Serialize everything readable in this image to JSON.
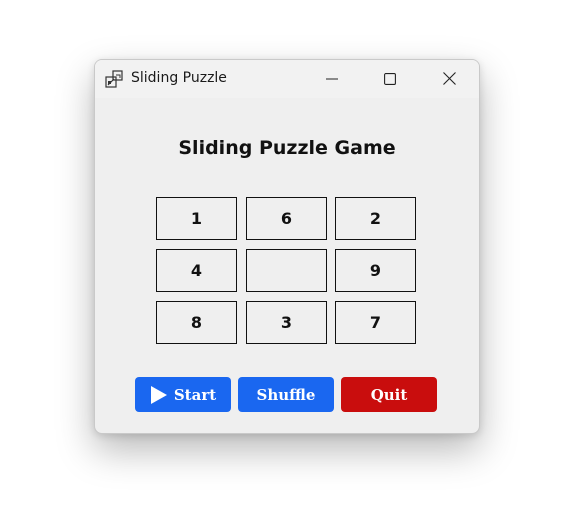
{
  "window": {
    "title": "Sliding Puzzle",
    "controls": {
      "minimize_icon": "minimize-icon",
      "maximize_icon": "maximize-icon",
      "close_icon": "close-icon"
    }
  },
  "game": {
    "heading": "Sliding Puzzle Game",
    "tiles": [
      "1",
      "6",
      "2",
      "4",
      "",
      "9",
      "8",
      "3",
      "7"
    ]
  },
  "actions": {
    "start_label": "Start",
    "shuffle_label": "Shuffle",
    "quit_label": "Quit",
    "start_icon": "play-icon"
  },
  "colors": {
    "start": "#1a67f0",
    "shuffle": "#1a67f0",
    "quit": "#c90d0d",
    "window_bg": "#efefef"
  }
}
